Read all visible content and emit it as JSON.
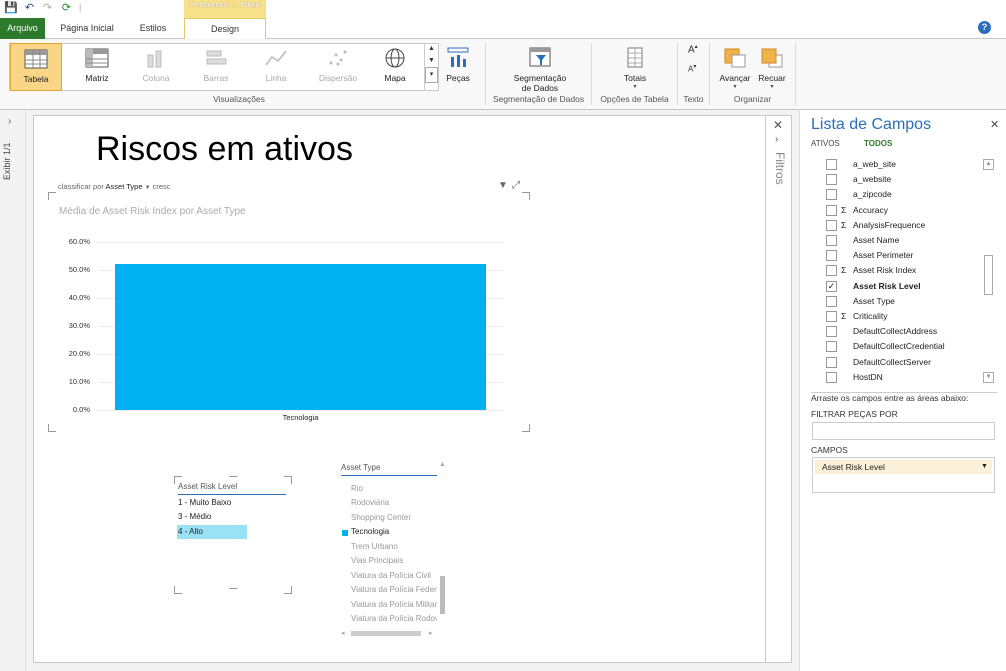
{
  "tabs": {
    "file": "Arquivo",
    "home": "Página Inicial",
    "styles": "Estilos",
    "design": "Design",
    "tools_header": "Ferramentas de Tabela"
  },
  "ribbon": {
    "visualizations": [
      "Tabela",
      "Matriz",
      "Coluna",
      "Barras",
      "Linha",
      "Dispersão",
      "Mapa"
    ],
    "pecas": "Peças",
    "slicer": "Segmentação\nde Dados",
    "totais": "Totais",
    "avancar": "Avançar",
    "recuar": "Recuar",
    "groups": [
      "Visualizações",
      "Segmentação de Dados",
      "Opções de Tabela",
      "Texto",
      "Organizar"
    ]
  },
  "left_strip": {
    "label": "Exibir 1/1"
  },
  "canvas": {
    "title": "Riscos em ativos",
    "sort_label": "classificar por",
    "sort_field": "Asset Type",
    "sort_dir": "cresc",
    "chart_title": "Média de Asset Risk Index por Asset Type"
  },
  "chart_data": {
    "type": "bar",
    "title": "Média de Asset Risk Index por Asset Type",
    "categories": [
      "Tecnologia"
    ],
    "values": [
      0.52
    ],
    "ylim": [
      0,
      0.6
    ],
    "yticks": [
      "0.0%",
      "10.0%",
      "20.0%",
      "30.0%",
      "40.0%",
      "50.0%",
      "60.0%"
    ],
    "bar_color": "#00b0f0"
  },
  "risk_slicer": {
    "header": "Asset Risk Level",
    "items": [
      "1 - Muito Baixo",
      "3 - Médio",
      "4 - Alto"
    ],
    "selected": "4 - Alto"
  },
  "type_slicer": {
    "header": "Asset Type",
    "items": [
      "Rio",
      "Rodoviária",
      "Shopping Center",
      "Tecnologia",
      "Trem Urbano",
      "Vias Principais",
      "Viatura da Polícia Civil",
      "Viatura da Polícia Federal",
      "Viatura da Polícia Militar",
      "Viatura da Polícia Rodoviária"
    ],
    "active": "Tecnologia"
  },
  "filters": {
    "label": "Filtros"
  },
  "fieldlist": {
    "title": "Lista de Campos",
    "tab_active": "ATIVOS",
    "tab_all": "TODOS",
    "fields": [
      {
        "name": "a_web_site",
        "sigma": false,
        "checked": false
      },
      {
        "name": "a_website",
        "sigma": false,
        "checked": false
      },
      {
        "name": "a_zipcode",
        "sigma": false,
        "checked": false
      },
      {
        "name": "Accuracy",
        "sigma": true,
        "checked": false
      },
      {
        "name": "AnalysisFrequence",
        "sigma": true,
        "checked": false
      },
      {
        "name": "Asset Name",
        "sigma": false,
        "checked": false
      },
      {
        "name": "Asset Perimeter",
        "sigma": false,
        "checked": false
      },
      {
        "name": "Asset Risk Index",
        "sigma": true,
        "checked": false
      },
      {
        "name": "Asset Risk Level",
        "sigma": false,
        "checked": true
      },
      {
        "name": "Asset Type",
        "sigma": false,
        "checked": false
      },
      {
        "name": "Criticality",
        "sigma": true,
        "checked": false
      },
      {
        "name": "DefaultCollectAddress",
        "sigma": false,
        "checked": false
      },
      {
        "name": "DefaultCollectCredential",
        "sigma": false,
        "checked": false
      },
      {
        "name": "DefaultCollectServer",
        "sigma": false,
        "checked": false
      },
      {
        "name": "HostDN",
        "sigma": false,
        "checked": false
      }
    ],
    "drag_hint": "Arraste os campos entre as áreas abaixo:",
    "filter_tiles": "FILTRAR PEÇAS POR",
    "fields_label": "CAMPOS",
    "fields_value": "Asset Risk Level"
  }
}
